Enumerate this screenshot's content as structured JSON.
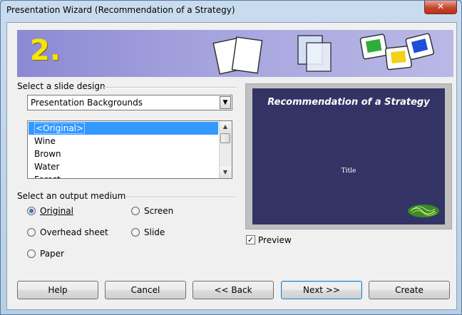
{
  "window": {
    "title": "Presentation Wizard (Recommendation of a Strategy)",
    "close_label": "✕"
  },
  "banner": {
    "step_number": "2."
  },
  "slide_design": {
    "group_label": "Select a slide design",
    "category_selected": "Presentation Backgrounds",
    "designs": [
      "<Original>",
      "Wine",
      "Brown",
      "Water",
      "Forest"
    ],
    "selected_index": 0
  },
  "output_medium": {
    "group_label": "Select an output medium",
    "options": [
      "Original",
      "Overhead sheet",
      "Paper",
      "Screen",
      "Slide"
    ],
    "selected": "Original"
  },
  "preview": {
    "slide_title": "Recommendation of a Strategy",
    "slide_subtitle": "Title",
    "checkbox_label": "Preview",
    "checked": true,
    "background_color": "#333366"
  },
  "buttons": {
    "help": "Help",
    "cancel": "Cancel",
    "back": "<< Back",
    "next": "Next >>",
    "create": "Create"
  }
}
